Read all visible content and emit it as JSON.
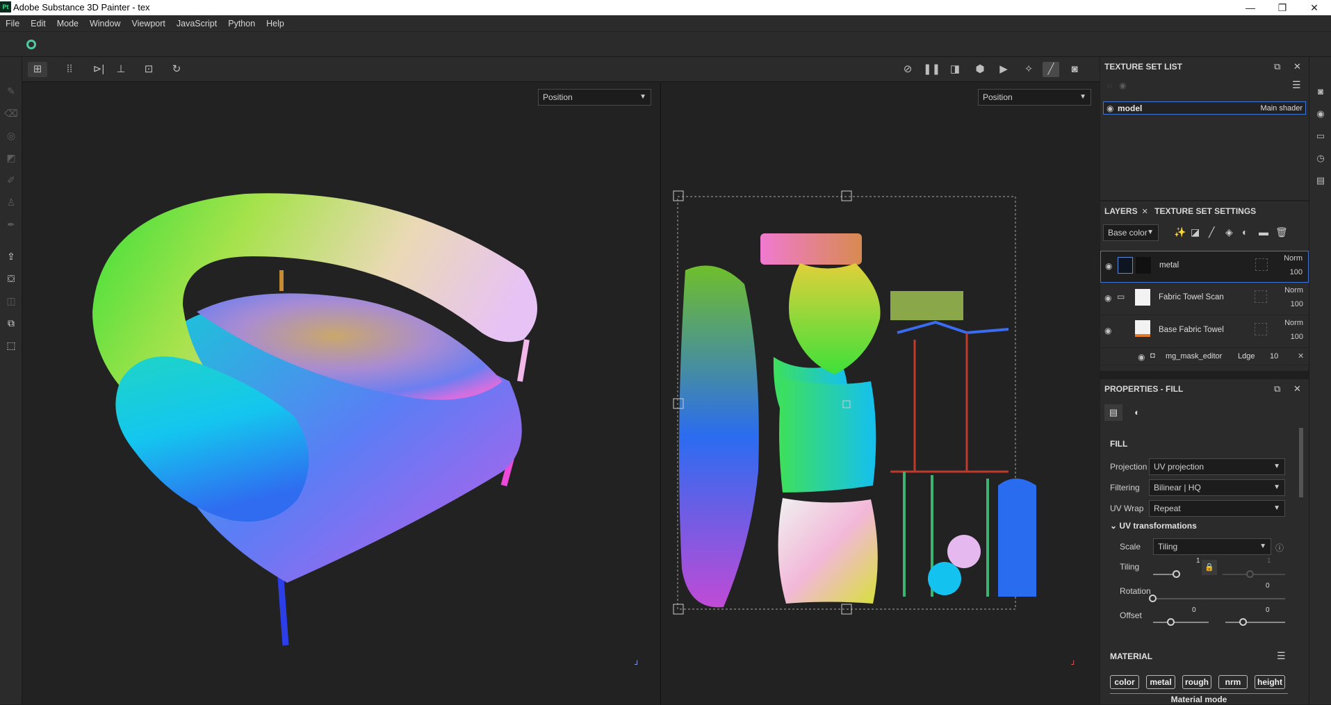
{
  "window": {
    "title": "Adobe Substance 3D Painter - tex",
    "app_icon": "Pt",
    "minimize": "—",
    "maximize": "❐",
    "close": "✕"
  },
  "menu": [
    "File",
    "Edit",
    "Mode",
    "Window",
    "Viewport",
    "JavaScript",
    "Python",
    "Help"
  ],
  "viewport3d": {
    "channel": "Position"
  },
  "viewport2d": {
    "channel": "Position"
  },
  "texture_set_list": {
    "title": "TEXTURE SET LIST",
    "item": {
      "name": "model",
      "shader": "Main shader"
    }
  },
  "layers": {
    "tab_layers": "LAYERS",
    "tab_settings": "TEXTURE SET SETTINGS",
    "channel": "Base color",
    "rows": [
      {
        "name": "metal",
        "blend": "Norm",
        "opacity": "100"
      },
      {
        "name": "Fabric Towel Scan",
        "blend": "Norm",
        "opacity": "100"
      },
      {
        "name": "Base Fabric Towel",
        "blend": "Norm",
        "opacity": "100"
      }
    ],
    "sub": {
      "name": "mg_mask_editor",
      "blend": "Ldge",
      "opacity": "10"
    }
  },
  "properties": {
    "title": "PROPERTIES - FILL",
    "fill_label": "FILL",
    "projection_label": "Projection",
    "projection": "UV projection",
    "filtering_label": "Filtering",
    "filtering": "Bilinear | HQ",
    "uvwrap_label": "UV Wrap",
    "uvwrap": "Repeat",
    "uvtrans_label": "UV transformations",
    "scale_label": "Scale",
    "scale": "Tiling",
    "tiling_label": "Tiling",
    "tiling_a": "1",
    "tiling_b": "1",
    "rotation_label": "Rotation",
    "rotation": "0",
    "offset_label": "Offset",
    "offset_a": "0",
    "offset_b": "0",
    "material_label": "MATERIAL",
    "material_buttons": [
      "color",
      "metal",
      "rough",
      "nrm",
      "height"
    ],
    "material_mode": "Material mode"
  }
}
